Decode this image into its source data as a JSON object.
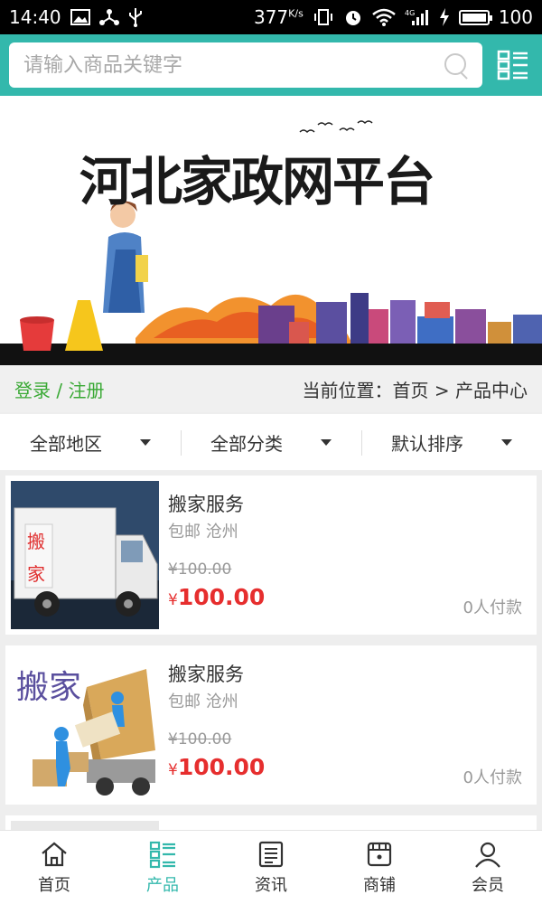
{
  "status_bar": {
    "time": "14:40",
    "net_speed": "377",
    "net_unit": "K/s",
    "battery": "100",
    "battery_level_percent": 100,
    "left_icons": [
      "image-icon",
      "usb-share-icon",
      "usb-icon"
    ],
    "right_icons": [
      "vibrate-icon",
      "alarm-icon",
      "wifi-icon",
      "signal-4g-icon",
      "charging-icon",
      "battery-icon"
    ]
  },
  "search": {
    "placeholder": "请输入商品关键字",
    "icon": "search-icon"
  },
  "banner": {
    "title": "河北家政网平台"
  },
  "breadcrumb": {
    "login": "登录",
    "separator": " / ",
    "register": "注册",
    "prefix": "当前位置：",
    "home": "首页",
    "arrow": " > ",
    "current": "产品中心"
  },
  "filters": [
    {
      "label": "全部地区"
    },
    {
      "label": "全部分类"
    },
    {
      "label": "默认排序"
    }
  ],
  "products": [
    {
      "title": "搬家服务",
      "subtitle": "包邮 沧州",
      "old_price": "¥100.00",
      "currency": "¥",
      "price": "100.00",
      "sold": "0人付款",
      "image_text": [
        "搬",
        "家"
      ]
    },
    {
      "title": "搬家服务",
      "subtitle": "包邮 沧州",
      "old_price": "¥100.00",
      "currency": "¥",
      "price": "100.00",
      "sold": "0人付款",
      "image_text": [
        "搬家"
      ]
    }
  ],
  "bottom_nav": [
    {
      "label": "首页",
      "icon": "home-icon",
      "active": false
    },
    {
      "label": "产品",
      "icon": "product-list-icon",
      "active": true
    },
    {
      "label": "资讯",
      "icon": "news-icon",
      "active": false
    },
    {
      "label": "商铺",
      "icon": "shop-icon",
      "active": false
    },
    {
      "label": "会员",
      "icon": "member-icon",
      "active": false
    }
  ],
  "colors": {
    "accent": "#33b8ac",
    "login_green": "#3aa935",
    "price_red": "#e62e2e"
  }
}
